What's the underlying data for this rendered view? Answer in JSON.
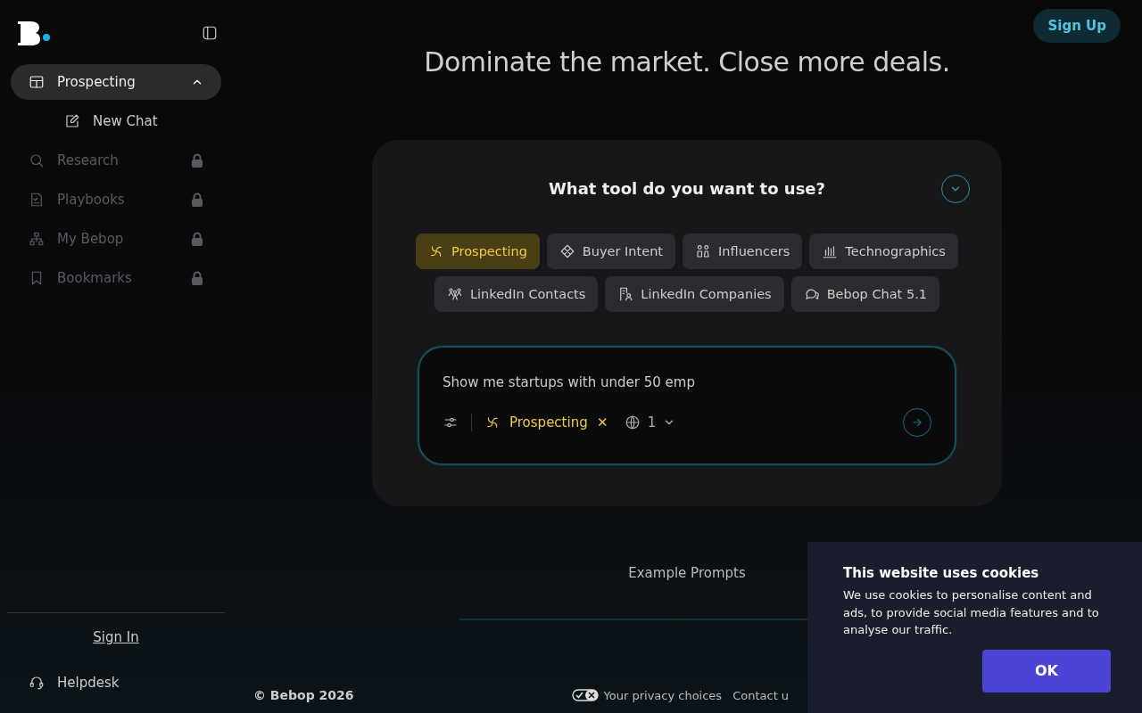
{
  "sidebar": {
    "items": [
      {
        "label": "Prospecting",
        "kind": "table",
        "selected": true,
        "expanded": true,
        "locked": false,
        "children": [
          {
            "label": "New Chat",
            "kind": "edit",
            "selected": false,
            "locked": false
          }
        ]
      },
      {
        "label": "Research",
        "kind": "research",
        "selected": false,
        "locked": true
      },
      {
        "label": "Playbooks",
        "kind": "doc",
        "selected": false,
        "locked": true
      },
      {
        "label": "My Bebop",
        "kind": "org",
        "selected": false,
        "locked": true
      },
      {
        "label": "Bookmarks",
        "kind": "bookmark",
        "selected": false,
        "locked": true
      }
    ],
    "sign_in": "Sign In",
    "helpdesk": "Helpdesk"
  },
  "header": {
    "sign_up": "Sign Up",
    "headline": "Dominate the market. Close more deals."
  },
  "tool_card": {
    "title": "What tool do you want to use?",
    "expanded": true,
    "tools": [
      [
        {
          "label": "Prospecting",
          "kind": "spiral",
          "selected": true
        },
        {
          "label": "Buyer Intent",
          "kind": "diamond",
          "selected": false
        },
        {
          "label": "Influencers",
          "kind": "people",
          "selected": false
        },
        {
          "label": "Technographics",
          "kind": "bars",
          "selected": false
        }
      ],
      [
        {
          "label": "LinkedIn Contacts",
          "kind": "group",
          "selected": false
        },
        {
          "label": "LinkedIn Companies",
          "kind": "company",
          "selected": false
        },
        {
          "label": "Bebop Chat 5.1",
          "kind": "chat",
          "selected": false
        }
      ]
    ],
    "prompt": {
      "value": "Show me startups with under 50 emp",
      "tool": "Prospecting",
      "remove": "✕",
      "count": "1"
    }
  },
  "examples": "Example Prompts",
  "footer": {
    "copyright": "© Bebop 2026",
    "links": [
      "Your privacy choices",
      "Contact u"
    ]
  },
  "cookie": {
    "title": "This website uses cookies",
    "text": "We use cookies to personalise content and ads, to provide social media features and to analyse our traffic.",
    "ok": "OK"
  }
}
